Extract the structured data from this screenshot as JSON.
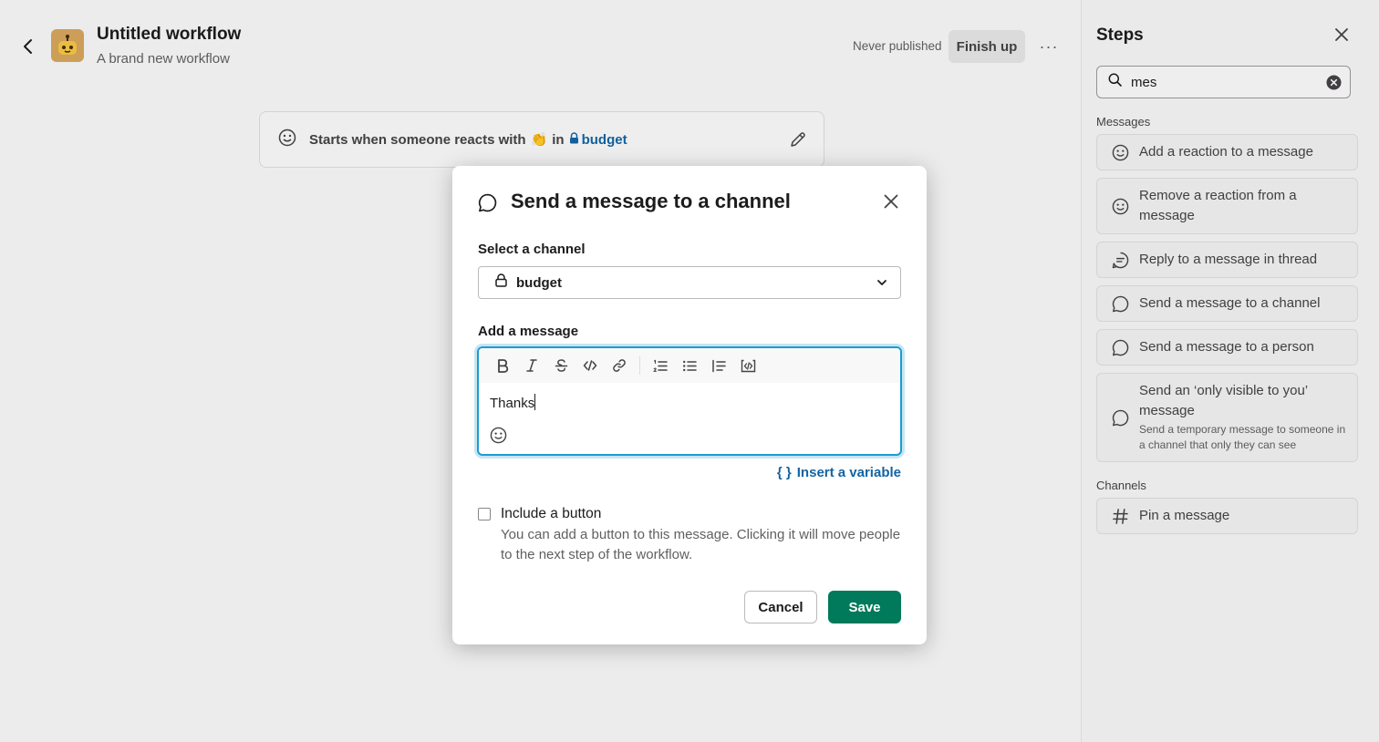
{
  "workflow": {
    "title": "Untitled workflow",
    "subtitle": "A brand new workflow",
    "publish_status": "Never published",
    "finish_label": "Finish up",
    "more_label": "···"
  },
  "trigger": {
    "text_prefix": "Starts when someone reacts with",
    "emoji": "👏",
    "in_word": "in",
    "channel": "budget"
  },
  "modal": {
    "title": "Send a message to a channel",
    "channel_label": "Select a channel",
    "channel_value": "budget",
    "message_label": "Add a message",
    "message_text": "Thanks",
    "insert_variable_brace": "{ }",
    "insert_variable": "Insert a variable",
    "include_button_label": "Include a button",
    "include_button_desc": "You can add a button to this message. Clicking it will move people to the next step of the workflow.",
    "cancel_label": "Cancel",
    "save_label": "Save",
    "toolbar": [
      "bold-icon",
      "italic-icon",
      "strikethrough-icon",
      "code-icon",
      "link-icon",
      "ordered-list-icon",
      "bullet-list-icon",
      "blockquote-icon",
      "code-block-icon"
    ]
  },
  "steps_panel": {
    "title": "Steps",
    "search_value": "mes",
    "sections": [
      {
        "label": "Messages",
        "items": [
          {
            "label": "Add a reaction to a message",
            "icon": "emoji-icon"
          },
          {
            "label": "Remove a reaction from a message",
            "icon": "emoji-icon"
          },
          {
            "label": "Reply to a message in thread",
            "icon": "thread-icon"
          },
          {
            "label": "Send a message to a channel",
            "icon": "message-icon"
          },
          {
            "label": "Send a message to a person",
            "icon": "message-icon"
          },
          {
            "label": "Send an ‘only visible to you’ message",
            "description": "Send a temporary message to someone in a channel that only they can see",
            "icon": "message-icon"
          }
        ]
      },
      {
        "label": "Channels",
        "items": [
          {
            "label": "Pin a message",
            "icon": "hash-icon"
          }
        ]
      }
    ]
  },
  "colors": {
    "accent_blue": "#1264a3",
    "save_green": "#007a5a",
    "focus_ring": "#1d9bd1"
  }
}
